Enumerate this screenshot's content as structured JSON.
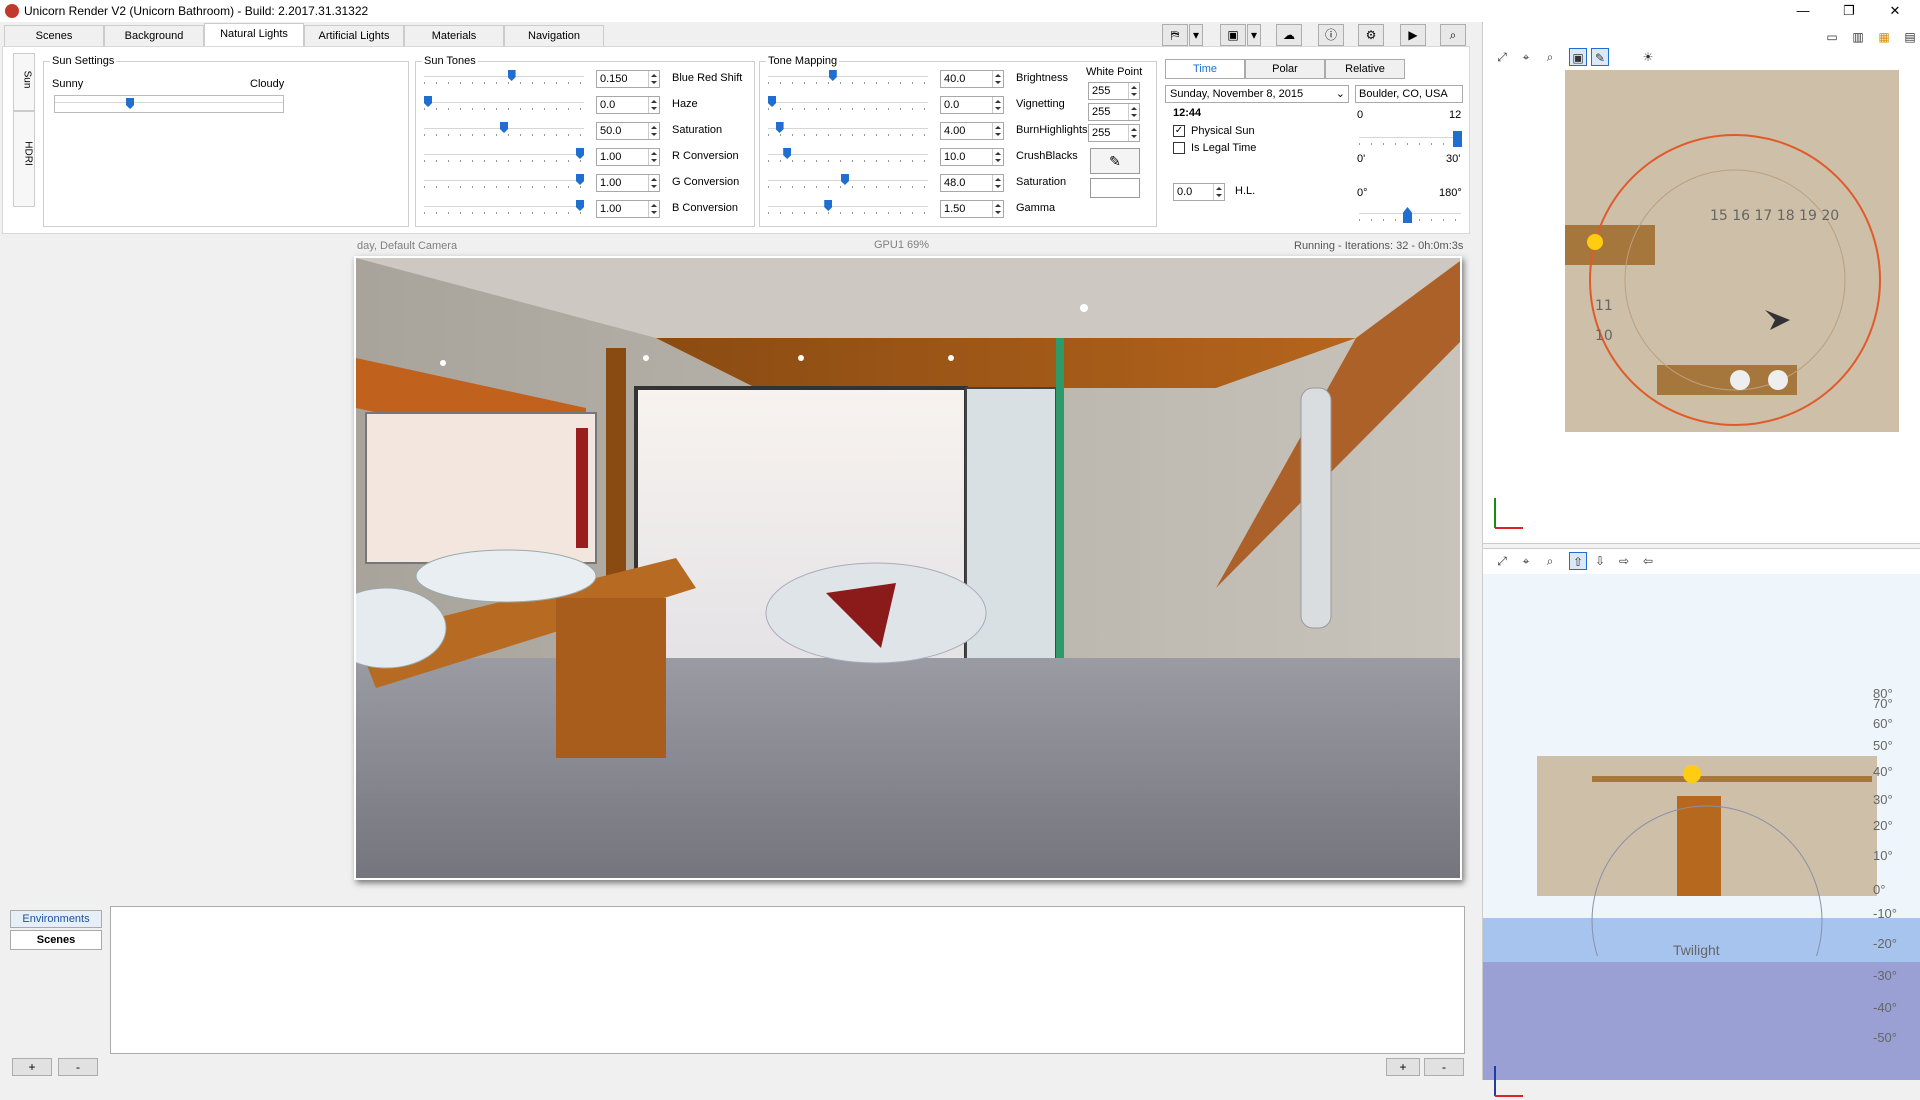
{
  "window": {
    "title": "Unicorn Render V2 (Unicorn Bathroom) - Build: 2.2017.31.31322",
    "minimize": "—",
    "restore": "❐",
    "close": "✕"
  },
  "tabs": [
    {
      "label": "Scenes"
    },
    {
      "label": "Background"
    },
    {
      "label": "Natural Lights"
    },
    {
      "label": "Artificial Lights"
    },
    {
      "label": "Materials"
    },
    {
      "label": "Navigation"
    }
  ],
  "vertical_tabs": {
    "sun": "Sun",
    "hdri": "HDRI"
  },
  "sun_settings": {
    "title": "Sun Settings",
    "left": "Sunny",
    "right": "Cloudy",
    "value": 0.32
  },
  "sun_tones": {
    "title": "Sun Tones",
    "rows": [
      {
        "label": "Blue Red Shift",
        "value": "0.150",
        "pos": 0.55
      },
      {
        "label": "Haze",
        "value": "0.0",
        "pos": 0.0
      },
      {
        "label": "Saturation",
        "value": "50.0",
        "pos": 0.5
      },
      {
        "label": "R Conversion",
        "value": "1.00",
        "pos": 1.0
      },
      {
        "label": "G Conversion",
        "value": "1.00",
        "pos": 1.0
      },
      {
        "label": "B Conversion",
        "value": "1.00",
        "pos": 1.0
      }
    ]
  },
  "tone_mapping": {
    "title": "Tone Mapping",
    "rows": [
      {
        "label": "Brightness",
        "value": "40.0",
        "pos": 0.4
      },
      {
        "label": "Vignetting",
        "value": "0.0",
        "pos": 0.0
      },
      {
        "label": "BurnHighlights",
        "value": "4.00",
        "pos": 0.05
      },
      {
        "label": "CrushBlacks",
        "value": "10.0",
        "pos": 0.1
      },
      {
        "label": "Saturation",
        "value": "48.0",
        "pos": 0.48
      },
      {
        "label": "Gamma",
        "value": "1.50",
        "pos": 0.37
      }
    ],
    "white_point_label": "White Point",
    "white_point": [
      "255",
      "255",
      "255"
    ]
  },
  "time_tabs": [
    {
      "label": "Time"
    },
    {
      "label": "Polar"
    },
    {
      "label": "Relative"
    }
  ],
  "date": {
    "day": "Sunday",
    "rest": ",  November   8, 2015",
    "time": "12:44"
  },
  "location": "Boulder, CO, USA",
  "physical_sun": "Physical Sun",
  "legal_time": "Is Legal Time",
  "hl": {
    "value": "0.0",
    "label": "H.L."
  },
  "ranges": [
    {
      "min": "0",
      "max": "12"
    },
    {
      "min": "0'",
      "max": "30'"
    },
    {
      "min": "0°",
      "max": "180°"
    }
  ],
  "status": {
    "camera": "day, Default Camera",
    "gpu": "GPU1 69%",
    "progress": "Running - Iterations: 32 - 0h:0m:3s"
  },
  "bottom_tabs": [
    {
      "label": "Environments"
    },
    {
      "label": "Scenes"
    }
  ],
  "bottom_buttons": {
    "add": "+",
    "remove": "-"
  },
  "elevation_ticks": [
    "80°",
    "70°",
    "60°",
    "50°",
    "40°",
    "30°",
    "20°",
    "10°",
    "0°",
    "-10°",
    "-20°",
    "-30°",
    "-40°",
    "-50°"
  ],
  "twilight": "Twilight",
  "icons": {
    "colors": {
      "accent": "#1e6fd0",
      "sky_day": "#eef6fb",
      "sky_night": "#9aa0d4"
    }
  }
}
